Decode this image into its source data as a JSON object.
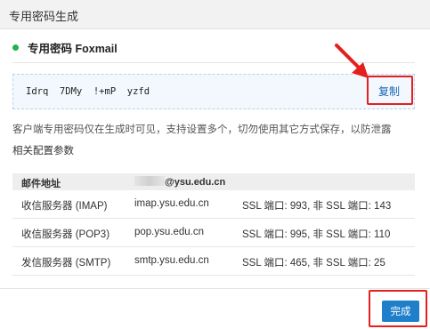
{
  "dialog": {
    "title": "专用密码生成"
  },
  "section": {
    "title": "专用密码 Foxmail",
    "status_color": "#22b14c"
  },
  "password": {
    "value": "Idrq  7DMy  !+mP  yzfd",
    "copy_label": "复制"
  },
  "hint": "客户端专用密码仅在生成时可见，支持设置多个，切勿使用其它方式保存，以防泄露",
  "config": {
    "title": "相关配置参数",
    "header": {
      "label": "邮件地址",
      "email_domain": "@ysu.edu.cn"
    },
    "rows": [
      {
        "name": "收信服务器 (IMAP)",
        "host": "imap.ysu.edu.cn",
        "ports": "SSL 端口: 993, 非 SSL 端口: 143"
      },
      {
        "name": "收信服务器 (POP3)",
        "host": "pop.ysu.edu.cn",
        "ports": "SSL 端口: 995, 非 SSL 端口: 110"
      },
      {
        "name": "发信服务器 (SMTP)",
        "host": "smtp.ysu.edu.cn",
        "ports": "SSL 端口: 465, 非 SSL 端口: 25"
      }
    ]
  },
  "footer": {
    "done_label": "完成"
  },
  "colors": {
    "accent": "#1f7fcb",
    "annotation": "#e4201f"
  }
}
